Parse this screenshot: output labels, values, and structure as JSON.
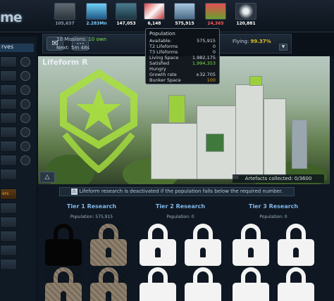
{
  "app": {
    "logo_text": "me"
  },
  "resources": [
    {
      "value": "105,637",
      "icon": "metal-icon",
      "color": "#8a9aaa"
    },
    {
      "value": "2.283Mn",
      "icon": "crystal-icon",
      "color": "#7fd0ff"
    },
    {
      "value": "147,053",
      "icon": "deuterium-icon",
      "color": "#ffffff"
    },
    {
      "value": "6,148",
      "icon": "energy-icon",
      "color": "#ffffff"
    },
    {
      "value": "575,915",
      "icon": "population-icon",
      "color": "#ffffff"
    },
    {
      "value": "24,365",
      "icon": "food-icon",
      "color": "#ff5a5a"
    },
    {
      "value": "120,881",
      "icon": "dark-matter-icon",
      "color": "#ffffff"
    }
  ],
  "leftnav": {
    "header": "rves",
    "active_label": "ers"
  },
  "missions": {
    "text_prefix": "10 Missions: ",
    "text_highlight": "10 own",
    "next_label": "Next: 5m 48s",
    "flying_label": "Flying: ",
    "flying_value": "99.37%"
  },
  "hero": {
    "title": "Lifeform R",
    "artefacts": "Artefacts collected: 0/3600"
  },
  "warning": "Lifeform research is deactivated if the population falls below the required number.",
  "tiers": [
    {
      "title": "Tier 1 Research",
      "population": "Population: 575,915"
    },
    {
      "title": "Tier 2 Research",
      "population": "Population: 0"
    },
    {
      "title": "Tier 3 Research",
      "population": "Population: 0"
    }
  ],
  "tooltip": {
    "title": "Population",
    "rows": [
      {
        "label": "Available:",
        "value": "575,915",
        "color": ""
      },
      {
        "label": "T2 Lifeforms",
        "value": "0",
        "color": ""
      },
      {
        "label": "T3 Lifeforms",
        "value": "0",
        "color": ""
      },
      {
        "label": "Living Space",
        "value": "1,982,175",
        "color": ""
      },
      {
        "label": "Satisfied",
        "value": "1,994,353",
        "color": "green"
      },
      {
        "label": "Hungry",
        "value": "",
        "color": ""
      },
      {
        "label": "Growth rate",
        "value": "±32.705",
        "color": ""
      },
      {
        "label": "Bunker Space",
        "value": "100",
        "color": "orange"
      }
    ]
  }
}
